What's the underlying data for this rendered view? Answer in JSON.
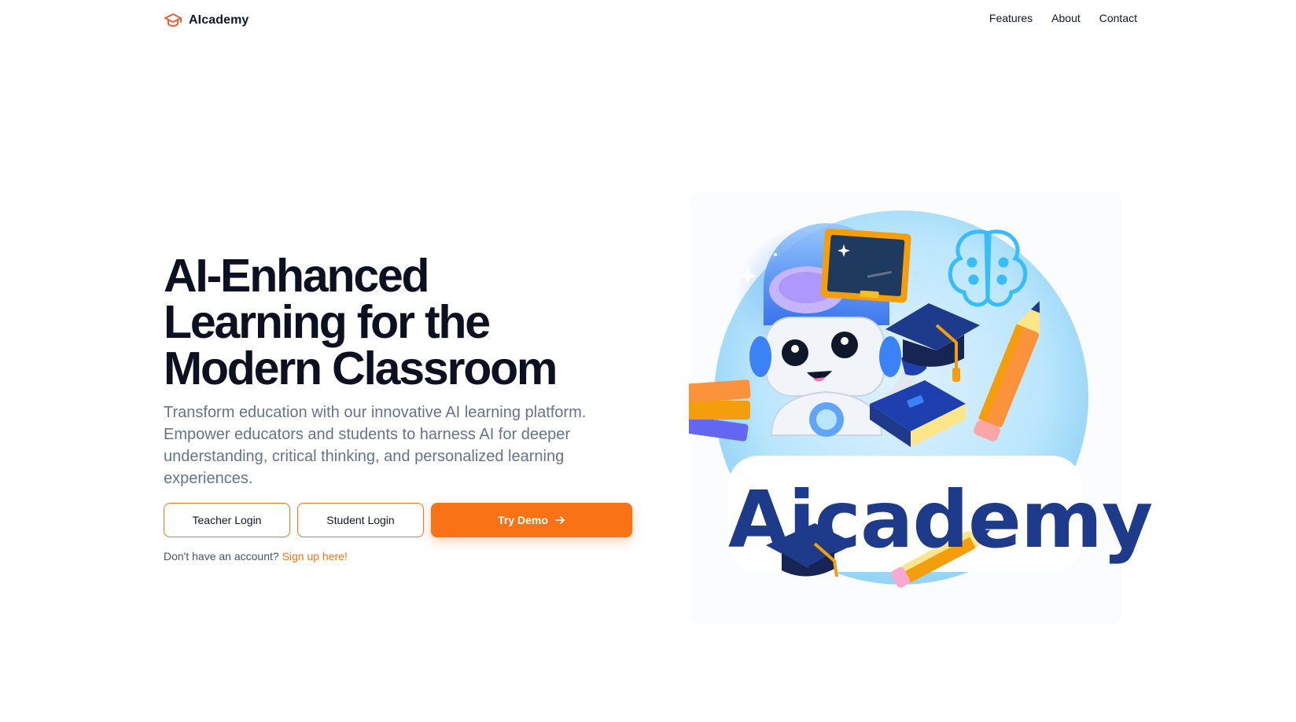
{
  "brand": {
    "name": "AIcademy",
    "icon": "graduation-cap-icon",
    "accent": "#f97316"
  },
  "nav": {
    "items": [
      "Features",
      "About",
      "Contact"
    ]
  },
  "hero": {
    "title_lines": [
      "AI-Enhanced",
      "Learning for the",
      "Modern Classroom"
    ],
    "subtitle": "Transform education with our innovative AI learning platform. Empower educators and students to harness AI for deeper understanding, critical thinking, and personalized learning experiences.",
    "teacher_login": "Teacher Login",
    "student_login": "Student Login",
    "try_demo": "Try Demo",
    "signup_prompt": "Don't have an account?",
    "signup_link": "Sign up here!"
  },
  "illustration": {
    "wordmark": "Aicademy",
    "icons": [
      "robot-icon",
      "brain-icon",
      "chalkboard-icon",
      "graduation-cap-icon",
      "books-icon",
      "pencil-icon",
      "book-icon"
    ]
  },
  "colors": {
    "primary": "#f97316",
    "heading": "#0b1120",
    "muted": "#64748b",
    "illustration_navy": "#1e3a8a",
    "illustration_sky": "#bae6fd"
  }
}
